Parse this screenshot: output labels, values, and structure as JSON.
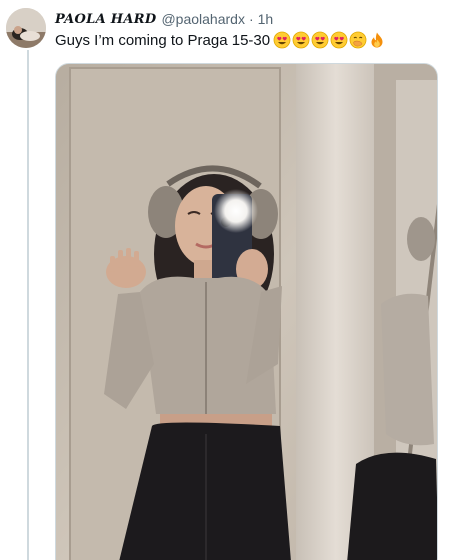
{
  "author": {
    "display_name": "PAOLA HARD",
    "handle": "@paolahardx",
    "separator": "·",
    "timestamp": "1h",
    "avatar_icon": "profile-photo"
  },
  "tweet": {
    "text": "Guys I’m coming to Praga 15-30",
    "emojis": [
      "heart-eyes-face",
      "heart-eyes-face",
      "heart-eyes-face",
      "heart-eyes-face",
      "face-with-hand-over-mouth",
      "fire"
    ]
  },
  "media": {
    "type": "photo",
    "description_icon": "mirror-selfie-photo"
  },
  "colors": {
    "text_primary": "#0f1419",
    "text_secondary": "#536471",
    "thread_line": "#cfd9de"
  }
}
